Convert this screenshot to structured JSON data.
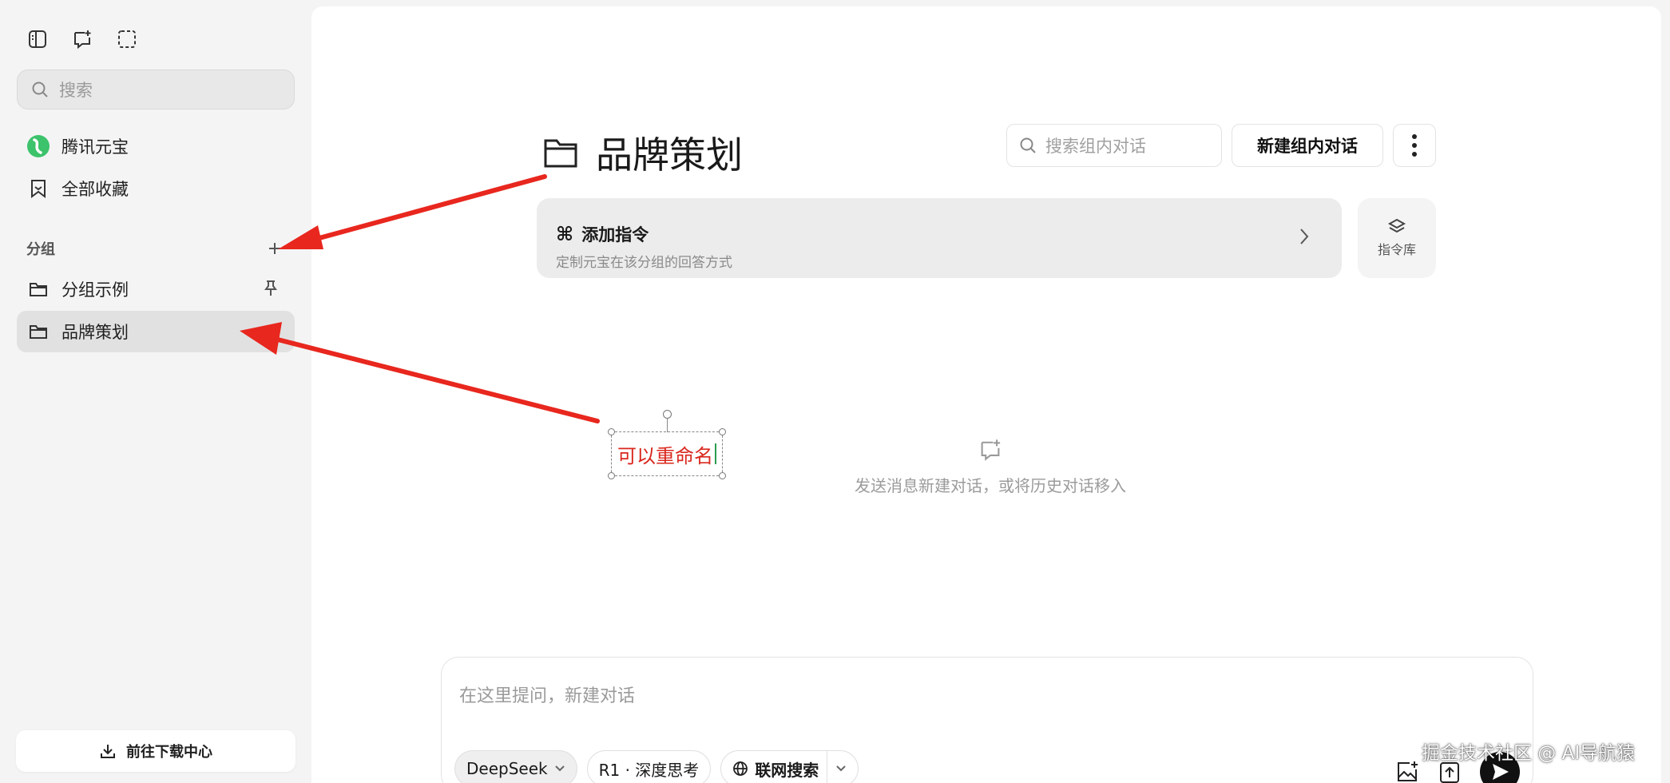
{
  "sidebar": {
    "search_placeholder": "搜索",
    "nav": [
      {
        "label": "腾讯元宝"
      },
      {
        "label": "全部收藏"
      }
    ],
    "group_header": "分组",
    "groups": [
      {
        "label": "分组示例",
        "pinned": true
      },
      {
        "label": "品牌策划",
        "active": true
      }
    ],
    "download_label": "前往下载中心"
  },
  "main": {
    "title": "品牌策划",
    "inner_search_placeholder": "搜索组内对话",
    "new_chat_label": "新建组内对话",
    "instruction": {
      "title": "添加指令",
      "subtitle": "定制元宝在该分组的回答方式"
    },
    "library_label": "指令库",
    "empty_message": "发送消息新建对话，或将历史对话移入",
    "annotation": "可以重命名",
    "composer": {
      "placeholder": "在这里提问，新建对话",
      "model": "DeepSeek",
      "deep_think": "R1 · 深度思考",
      "web_search": "联网搜索"
    }
  },
  "watermark": "掘金技术社区 @ AI导航猿",
  "colors": {
    "accent_red": "#e8271e",
    "brand_green": "#2a9d4f"
  }
}
